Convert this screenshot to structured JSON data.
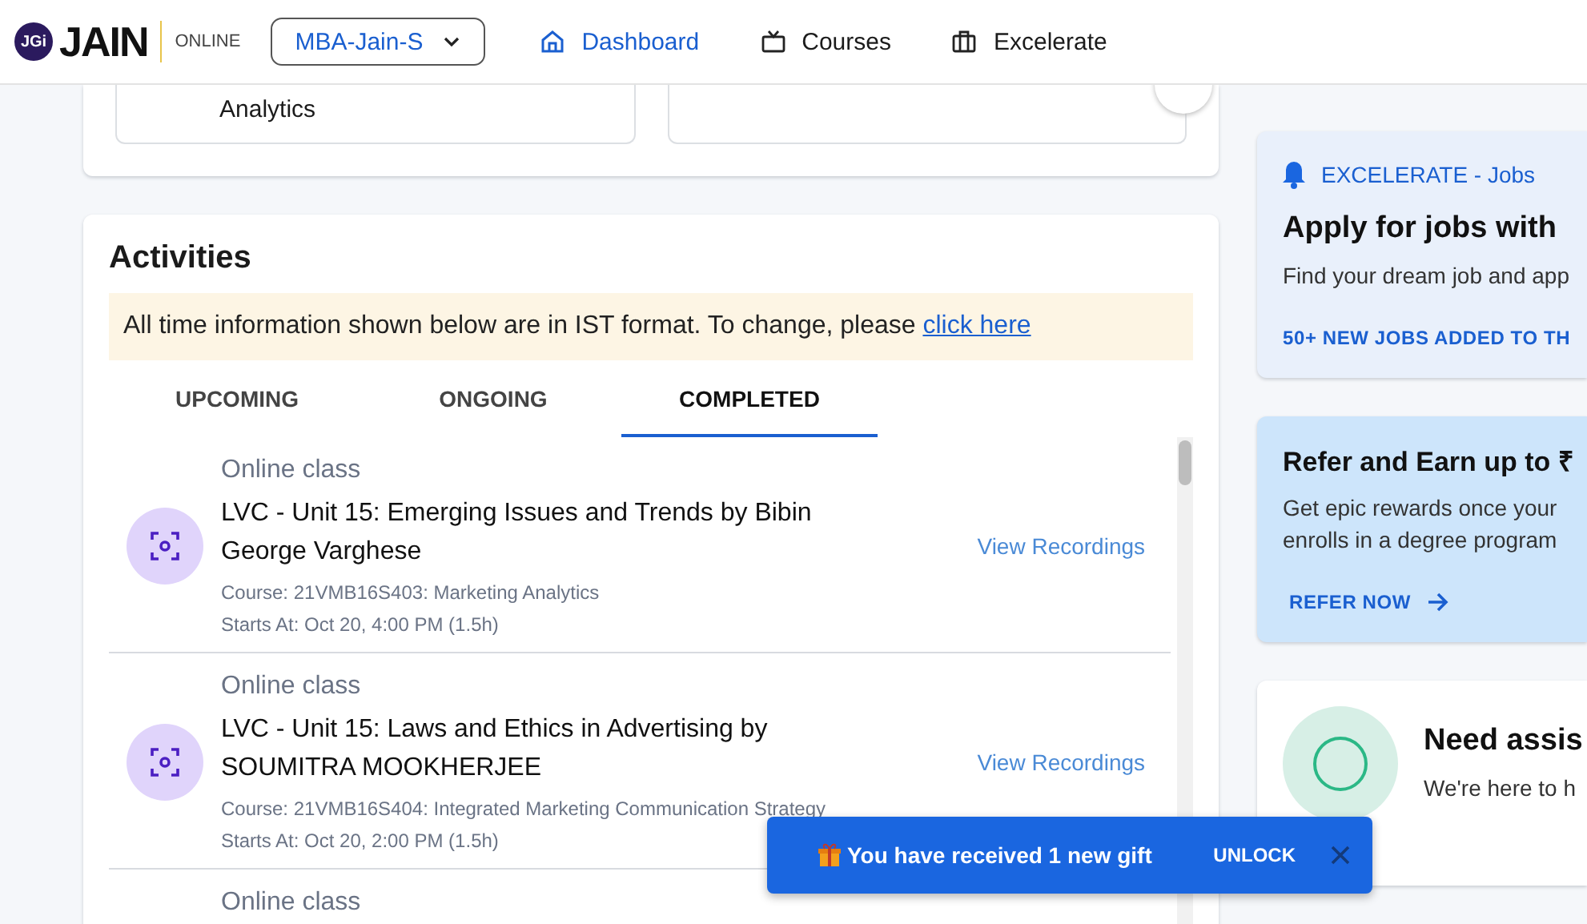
{
  "header": {
    "logo": {
      "badge": "JGi",
      "brand": "JAIN",
      "tagline": "ONLINE"
    },
    "program_select": {
      "value": "MBA-Jain-S"
    },
    "nav": [
      {
        "label": "Dashboard",
        "selected": true
      },
      {
        "label": "Courses",
        "selected": false
      },
      {
        "label": "Excelerate",
        "selected": false
      }
    ]
  },
  "course_cards": [
    {
      "title": "Analytics"
    }
  ],
  "activities": {
    "title": "Activities",
    "notice": {
      "text": "All time information shown below are in IST format. To change, please",
      "link": "click here"
    },
    "tabs": [
      {
        "label": "UPCOMING",
        "selected": false
      },
      {
        "label": "ONGOING",
        "selected": false
      },
      {
        "label": "COMPLETED",
        "selected": true
      }
    ],
    "items": [
      {
        "type": "Online class",
        "title": "LVC - Unit 15: Emerging Issues and Trends by Bibin George Varghese",
        "course": "Course: 21VMB16S403: Marketing Analytics",
        "starts": "Starts At: Oct 20, 4:00 PM (1.5h)",
        "action": "View Recordings"
      },
      {
        "type": "Online class",
        "title": "LVC - Unit 15: Laws and Ethics in Advertising by SOUMITRA MOOKHERJEE",
        "course": "Course: 21VMB16S404: Integrated Marketing Communication Strategy",
        "starts": "Starts At: Oct 20, 2:00 PM (1.5h)",
        "action": "View Recordings"
      },
      {
        "type": "Online class"
      }
    ]
  },
  "side_cards": [
    {
      "kind": "jobs",
      "label": "EXCELERATE - Jobs",
      "title": "Apply for jobs with",
      "text": "Find your dream job and app",
      "link": "50+ NEW JOBS ADDED TO TH"
    },
    {
      "kind": "refer",
      "title": "Refer and Earn up to ₹",
      "text": "Get epic rewards once your enrolls in a degree program",
      "link": "REFER NOW"
    },
    {
      "kind": "help",
      "title": "Need assis",
      "text": "We're here to h"
    }
  ],
  "toast": {
    "message": "You have received 1 new gift",
    "action": "UNLOCK"
  }
}
